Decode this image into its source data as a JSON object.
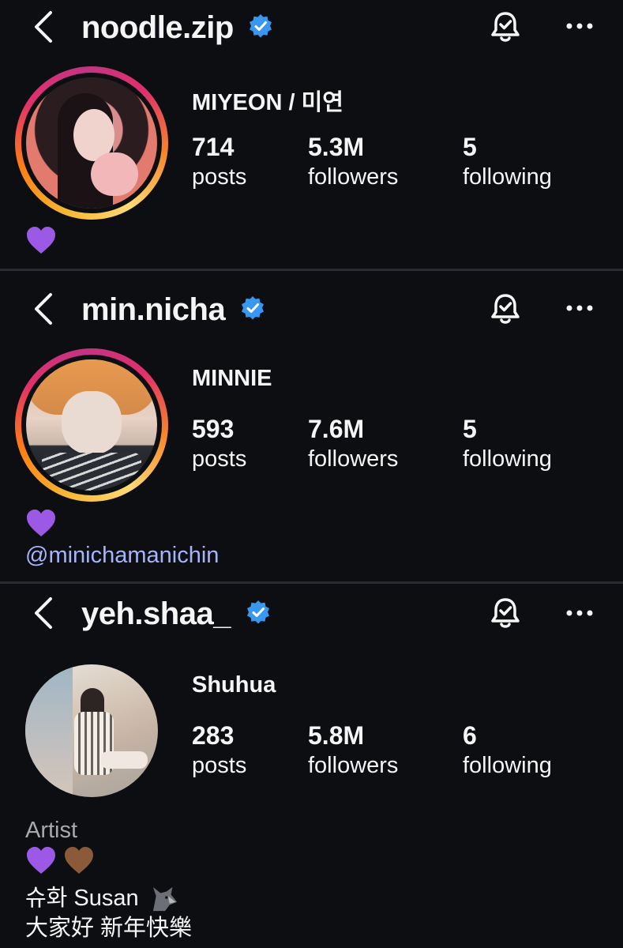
{
  "profiles": [
    {
      "username": "noodle.zip",
      "display_name": "MIYEON / 미연",
      "stats": [
        {
          "value": "714",
          "label": "posts"
        },
        {
          "value": "5.3M",
          "label": "followers"
        },
        {
          "value": "5",
          "label": "following"
        }
      ],
      "bio_hearts": [
        "purple-heart"
      ],
      "story_ring": true
    },
    {
      "username": "min.nicha",
      "display_name": "MINNIE",
      "stats": [
        {
          "value": "593",
          "label": "posts"
        },
        {
          "value": "7.6M",
          "label": "followers"
        },
        {
          "value": "5",
          "label": "following"
        }
      ],
      "bio_hearts": [
        "purple-heart"
      ],
      "mention": "@minichamanichin",
      "story_ring": true
    },
    {
      "username": "yeh.shaa_",
      "display_name": "Shuhua",
      "stats": [
        {
          "value": "283",
          "label": "posts"
        },
        {
          "value": "5.8M",
          "label": "followers"
        },
        {
          "value": "6",
          "label": "following"
        }
      ],
      "category": "Artist",
      "bio_hearts": [
        "purple-heart",
        "brown-heart"
      ],
      "bio_line_1": "슈화 Susan",
      "bio_line_1_emoji": "wolf",
      "bio_line_2": "大家好 新年快樂",
      "story_ring": false
    }
  ],
  "colors": {
    "background": "#0d0e12",
    "verified": "#3897f0",
    "link": "#a5b4fc",
    "purple_heart": "#9b59e6",
    "brown_heart": "#8a5a3b"
  },
  "icons": [
    "back-chevron-icon",
    "verified-badge-icon",
    "notification-bell-icon",
    "more-options-icon"
  ]
}
